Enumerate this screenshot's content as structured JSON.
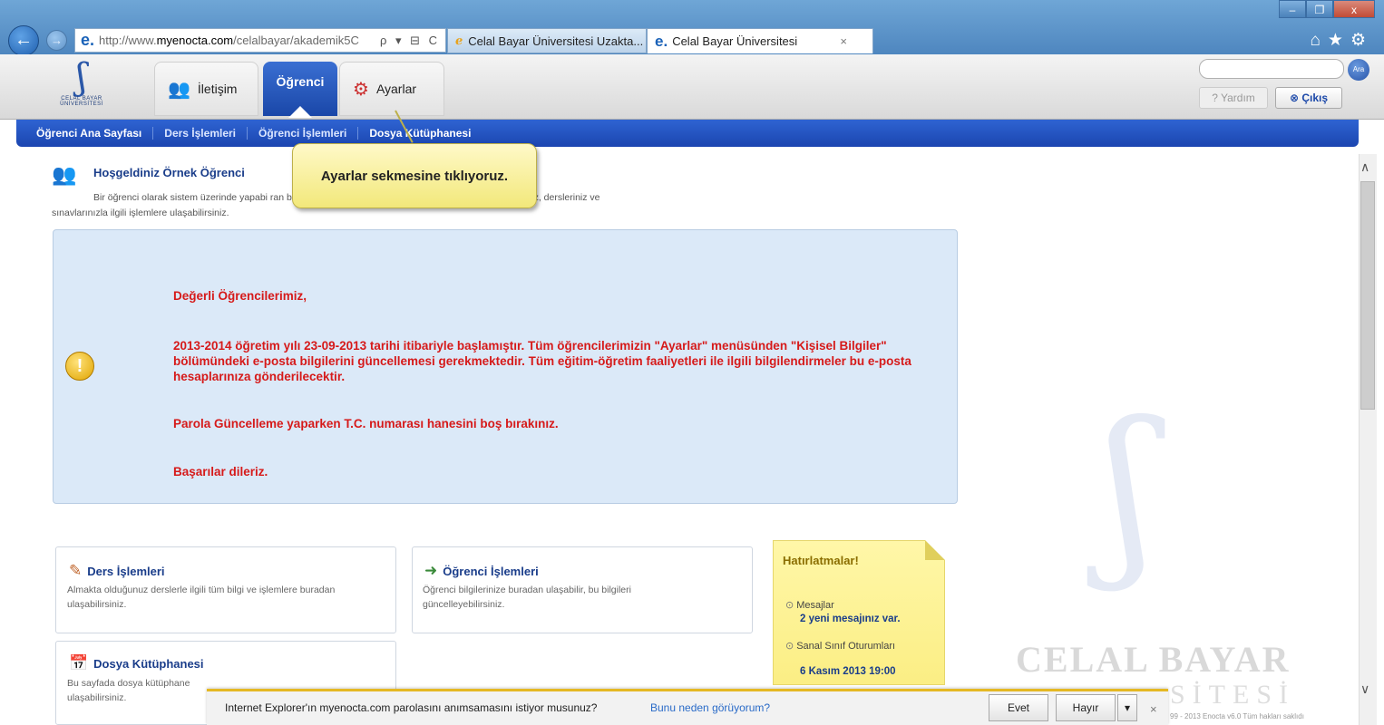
{
  "browser": {
    "url_host": "http://www.",
    "url_domain": "myenocta.com",
    "url_path": "/celalbayar/akademik5C",
    "address_tools": "ρ ▾ ⊟ C",
    "tabs": [
      {
        "label": "Celal Bayar Üniversitesi Uzakta..."
      },
      {
        "label": "Celal Bayar Üniversitesi",
        "close": "×"
      }
    ],
    "window_controls": {
      "minimize": "–",
      "maximize": "❐",
      "close": "x"
    },
    "toolbar_icons": "⌂★⚙"
  },
  "header": {
    "logo_text": "CELAL BAYAR",
    "logo_subtext": "ÜNİVERSİTESİ",
    "tabs": [
      {
        "label": "İletişim"
      },
      {
        "label": "Öğrenci"
      },
      {
        "label": "Ayarlar"
      }
    ],
    "search_button": "Ara",
    "help_button": "Yardım",
    "logout_button": "Çıkış"
  },
  "subnav": {
    "items": [
      "Öğrenci Ana Sayfası",
      "Ders İşlemleri",
      "Öğrenci İşlemleri",
      "Dosya Kütüphanesi"
    ]
  },
  "tooltip": {
    "text": "Ayarlar sekmesine tıklıyoruz."
  },
  "welcome": {
    "title": "Hoşgeldiniz Örnek Öğrenci",
    "desc_line1": "Bir öğrenci olarak sistem üzerinde yapabi                                                                                      ran burasıdır. Bu ekrandaki linkleri kullanarak öğrenci bilgileriniz, dersleriniz ve",
    "desc_line2": "sınavlarınızla ilgili işlemlere ulaşabilirsiniz."
  },
  "notice": {
    "greeting": "Değerli Öğrencilerimiz,",
    "paragraph": "2013-2014 öğretim yılı 23-09-2013 tarihi itibariyle başlamıştır. Tüm öğrencilerimizin \"Ayarlar\" menüsünden \"Kişisel Bilgiler\" bölümündeki e-posta bilgilerini güncellemesi gerekmektedir. Tüm eğitim-öğretim faaliyetleri ile ilgili bilgilendirmeler bu e-posta hesaplarınıza gönderilecektir.",
    "password_note": "Parola Güncelleme yaparken T.C. numarası hanesini boş bırakınız.",
    "closing": "Başarılar dileriz."
  },
  "cards": [
    {
      "title": "Ders İşlemleri",
      "desc": "Almakta olduğunuz derslerle ilgili tüm bilgi ve işlemlere buradan ulaşabilirsiniz."
    },
    {
      "title": "Öğrenci İşlemleri",
      "desc": "Öğrenci bilgilerinize buradan ulaşabilir, bu bilgileri güncelleyebilirsiniz."
    },
    {
      "title": "Dosya Kütüphanesi",
      "desc": "Bu sayfada dosya kütüphane",
      "desc2": "ulaşabilirsiniz."
    }
  ],
  "reminders": {
    "title": "Hatırlatmalar!",
    "items": [
      {
        "label": "Mesajlar",
        "value": "2 yeni mesajınız var."
      },
      {
        "label": "Sanal Sınıf Oturumları",
        "value": "6 Kasım 2013 19:00"
      }
    ]
  },
  "watermark": {
    "line1": "CELAL BAYAR",
    "line2": "SİTESİ"
  },
  "notification": {
    "message": "Internet Explorer'ın myenocta.com parolasını anımsamasını istiyor musunuz?",
    "link": "Bunu neden görüyorum?",
    "yes": "Evet",
    "no": "Hayır",
    "dropdown": "▾",
    "close": "×"
  },
  "footer": {
    "copyright": "99 - 2013 Enocta v6.0 Tüm hakları saklıdı"
  }
}
